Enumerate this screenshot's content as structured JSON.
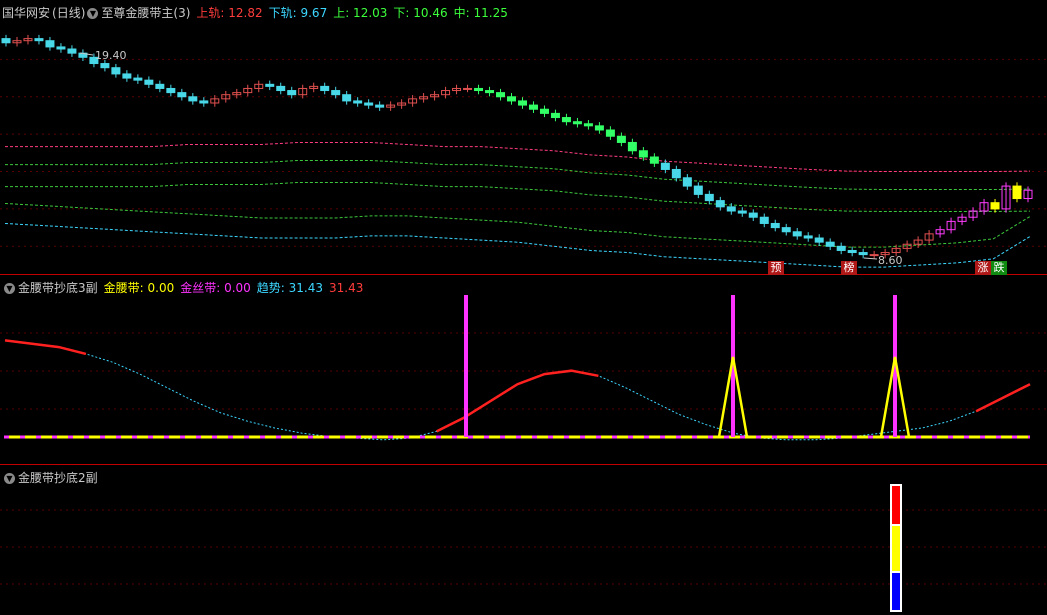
{
  "main": {
    "stock_name": "国华网安",
    "period": "(日线)",
    "indicator_name": "至尊金腰带主",
    "indicator_param": "(3)",
    "fields": [
      {
        "label": "上轨:",
        "value": "12.82",
        "color": "#ff3c3c"
      },
      {
        "label": "下轨:",
        "value": "9.67",
        "color": "#3cd7ff"
      },
      {
        "label": "上:",
        "value": "12.03",
        "color": "#3cff3c"
      },
      {
        "label": "下:",
        "value": "10.46",
        "color": "#3cff3c"
      },
      {
        "label": "中:",
        "value": "11.25",
        "color": "#3cff3c"
      }
    ],
    "high_label": "19.40",
    "low_label": "8.60",
    "tags": [
      {
        "text": "预",
        "color": "#c01010"
      },
      {
        "text": "榜",
        "color": "#c01010"
      },
      {
        "text": "涨",
        "color": "#c01010"
      },
      {
        "text": "跌",
        "color": "#10a010"
      }
    ]
  },
  "sub1": {
    "indicator_name": "金腰带抄底3副",
    "fields": [
      {
        "label": "金腰带:",
        "value": "0.00",
        "color": "#ffff00"
      },
      {
        "label": "金丝带:",
        "value": "0.00",
        "color": "#ff33ff"
      },
      {
        "label": "趋势:",
        "value": "31.43",
        "color": "#3cd7ff"
      },
      {
        "label": "",
        "value": "31.43",
        "color": "#ff3c3c"
      }
    ]
  },
  "sub2": {
    "indicator_name": "金腰带抄底2副"
  },
  "chart_data": [
    {
      "type": "candlestick",
      "series": [
        {
          "name": "上轨",
          "values": [
            14.0,
            14.0,
            14.0,
            14.0,
            14.0,
            14.1,
            14.1,
            14.1,
            14.2,
            14.2,
            14.2,
            14.1,
            14.0,
            14.0,
            13.9,
            13.8,
            13.6,
            13.5,
            13.3,
            13.2,
            13.1,
            13.0,
            12.9,
            12.82,
            12.8,
            12.8,
            12.8,
            12.8,
            12.82
          ]
        },
        {
          "name": "下轨",
          "values": [
            10.3,
            10.2,
            10.1,
            10.0,
            9.9,
            9.8,
            9.7,
            9.6,
            9.6,
            9.6,
            9.7,
            9.7,
            9.6,
            9.5,
            9.4,
            9.2,
            9.0,
            8.9,
            8.7,
            8.6,
            8.5,
            8.4,
            8.3,
            8.2,
            8.2,
            8.3,
            8.4,
            8.6,
            9.67
          ]
        }
      ],
      "ylim": [
        8.3,
        20.0
      ],
      "close": [
        19.0,
        19.1,
        19.2,
        19.1,
        18.8,
        18.7,
        18.5,
        18.3,
        18.0,
        17.8,
        17.5,
        17.3,
        17.2,
        17.0,
        16.8,
        16.6,
        16.4,
        16.2,
        16.1,
        16.3,
        16.5,
        16.6,
        16.8,
        17.0,
        16.9,
        16.7,
        16.5,
        16.8,
        16.9,
        16.7,
        16.5,
        16.2,
        16.1,
        16.0,
        15.9,
        16.0,
        16.1,
        16.3,
        16.4,
        16.5,
        16.7,
        16.8,
        16.8,
        16.7,
        16.6,
        16.4,
        16.2,
        16.0,
        15.8,
        15.6,
        15.4,
        15.2,
        15.1,
        15.0,
        14.8,
        14.5,
        14.2,
        13.8,
        13.5,
        13.2,
        12.9,
        12.5,
        12.1,
        11.7,
        11.4,
        11.1,
        10.9,
        10.8,
        10.6,
        10.3,
        10.1,
        9.9,
        9.7,
        9.6,
        9.4,
        9.2,
        9.0,
        8.9,
        8.8,
        8.8,
        8.9,
        9.1,
        9.3,
        9.5,
        9.8,
        10.0,
        10.4,
        10.6,
        10.9,
        11.3,
        11.0,
        12.1,
        11.5,
        11.9
      ]
    },
    {
      "type": "line",
      "title": "金腰带抄底3副",
      "series": [
        {
          "name": "趋势",
          "values": [
            88,
            86,
            84,
            80,
            75,
            68,
            60,
            52,
            45,
            40,
            36,
            33,
            31,
            30,
            29,
            30,
            34,
            42,
            52,
            62,
            68,
            70,
            67,
            60,
            52,
            44,
            38,
            33,
            30,
            29,
            29,
            30,
            32,
            34,
            36,
            40,
            46,
            54,
            62
          ]
        }
      ]
    },
    {
      "type": "bar",
      "title": "金腰带抄底2副"
    }
  ]
}
